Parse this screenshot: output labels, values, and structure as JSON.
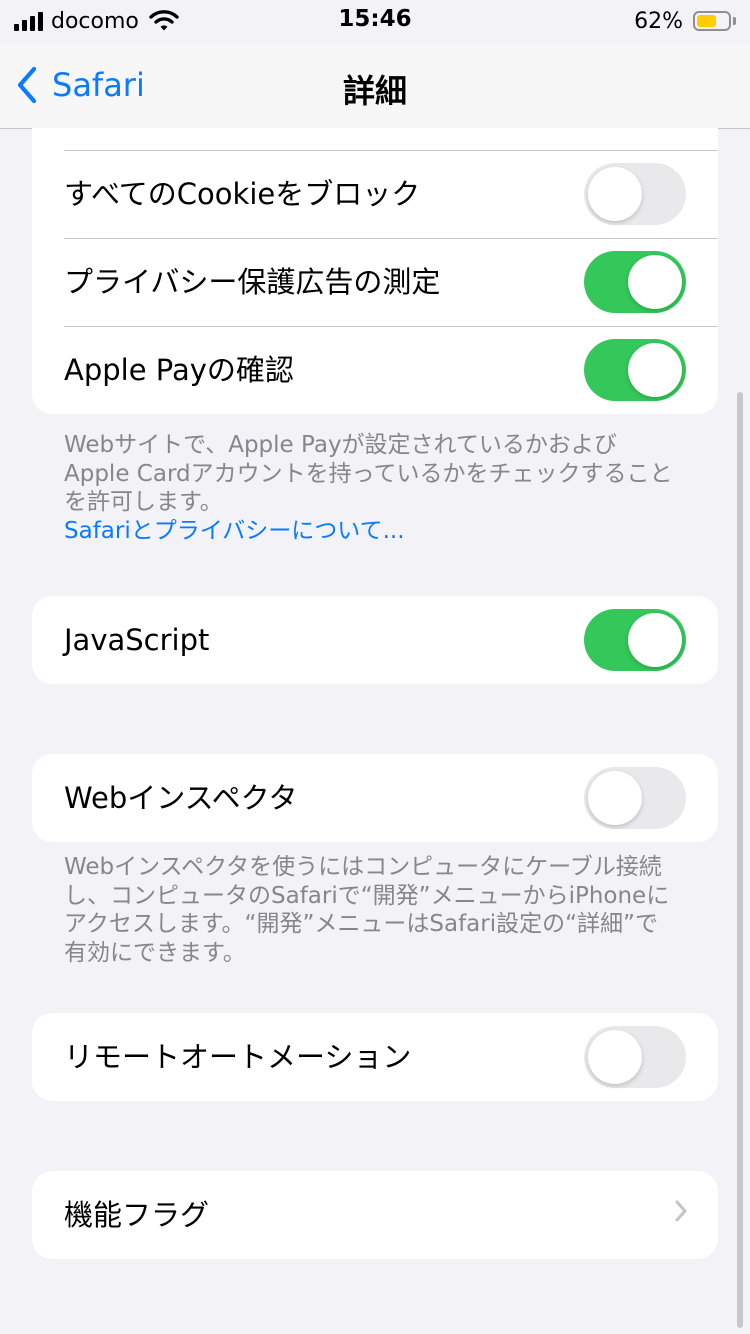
{
  "status_bar": {
    "carrier": "docomo",
    "time": "15:46",
    "battery_percent": "62%",
    "battery_level": 0.62,
    "battery_color": "#ffcc00"
  },
  "nav": {
    "back_label": "Safari",
    "title": "詳細"
  },
  "privacy_group": {
    "block_cookies_label": "すべてのCookieをブロック",
    "block_cookies_on": false,
    "privacy_ads_label": "プライバシー保護広告の測定",
    "privacy_ads_on": true,
    "apple_pay_label": "Apple Payの確認",
    "apple_pay_on": true
  },
  "apple_pay_note": {
    "lines": [
      "Webサイトで、Apple Payが設定されているかおよび",
      "Apple Cardアカウントを持っているかをチェックすること",
      "を許可します。"
    ],
    "link": "Safariとプライバシーについて..."
  },
  "javascript": {
    "label": "JavaScript",
    "on": true
  },
  "web_inspector": {
    "label": "Webインスペクタ",
    "on": false
  },
  "inspector_note": {
    "lines": [
      "Webインスペクタを使うにはコンピュータにケーブル接続",
      "し、コンピュータのSafariで“開発”メニューからiPhoneに",
      "アクセスします。“開発”メニューはSafari設定の“詳細”で",
      "有効にできます。"
    ]
  },
  "remote_automation": {
    "label": "リモートオートメーション",
    "on": false
  },
  "feature_flags": {
    "label": "機能フラグ"
  },
  "colors": {
    "accent": "#0a7aff",
    "toggle_on": "#34c759",
    "toggle_off": "#e9e9eb",
    "background": "#f2f2f7"
  }
}
